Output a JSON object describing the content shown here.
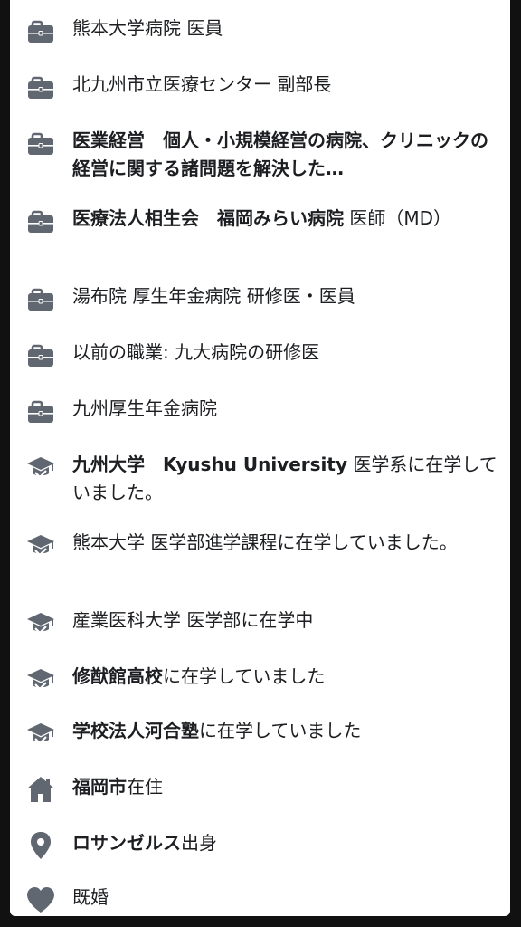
{
  "work": [
    {
      "bold": "",
      "text": "熊本大学病院 医員"
    },
    {
      "bold": "",
      "text": "北九州市立医療センター 副部長"
    },
    {
      "bold": "医業経営　個人・小規模経営の病院、クリニックの経営に関する諸問題を解決した…",
      "text": ""
    },
    {
      "bold": "医療法人相生会　福岡みらい病院",
      "text": " 医師（MD）"
    },
    {
      "bold": "",
      "text": "湯布院 厚生年金病院 研修医・医員"
    },
    {
      "bold": "",
      "text": "以前の職業: 九大病院の研修医"
    },
    {
      "bold": "",
      "text": "九州厚生年金病院"
    }
  ],
  "education": [
    {
      "bold": "九州大学　Kyushu University",
      "text": " 医学系に在学していました。"
    },
    {
      "bold": "",
      "text": "熊本大学 医学部進学課程に在学していました。"
    },
    {
      "bold": "",
      "text": "産業医科大学 医学部に在学中"
    },
    {
      "bold": "修猷館高校",
      "text": "に在学していました"
    },
    {
      "bold": "学校法人河合塾",
      "text": "に在学していました"
    }
  ],
  "current_city": {
    "bold": "福岡市",
    "text": "在住"
  },
  "hometown": {
    "bold": "ロサンゼルス",
    "text": "出身"
  },
  "relationship": {
    "text": "既婚"
  },
  "icon_names": {
    "work": "briefcase-icon",
    "education": "graduation-cap-icon",
    "current_city": "home-icon",
    "hometown": "location-pin-icon",
    "relationship": "heart-icon"
  },
  "colors": {
    "icon": "#606770",
    "text": "#1c1e21",
    "background": "#ffffff",
    "frame": "#111111"
  }
}
